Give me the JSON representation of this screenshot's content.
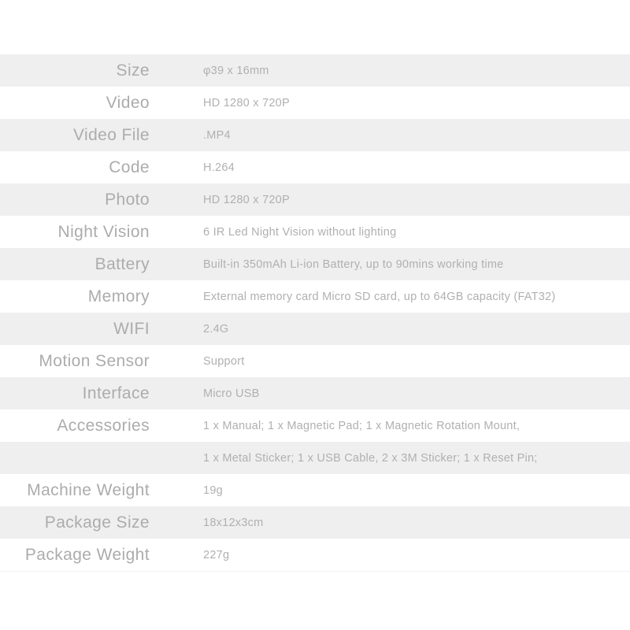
{
  "document": {
    "type": "product-specification-table",
    "colors": {
      "background": "#ffffff",
      "stripe": "#efefef",
      "label_text": "#acacac",
      "value_text": "#b0b0b0"
    }
  },
  "spec_table": {
    "rows": [
      {
        "label": "Size",
        "value": "φ39 x 16mm"
      },
      {
        "label": "Video",
        "value": "HD 1280 x 720P"
      },
      {
        "label": "Video File",
        "value": ".MP4"
      },
      {
        "label": "Code",
        "value": "H.264"
      },
      {
        "label": "Photo",
        "value": "HD 1280 x 720P"
      },
      {
        "label": "Night Vision",
        "value": "6 IR Led Night Vision without lighting"
      },
      {
        "label": "Battery",
        "value": "Built-in 350mAh Li-ion Battery, up to 90mins working time"
      },
      {
        "label": "Memory",
        "value": "External memory card Micro SD card, up to 64GB capacity (FAT32)"
      },
      {
        "label": "WIFI",
        "value": "2.4G"
      },
      {
        "label": "Motion Sensor",
        "value": "Support"
      },
      {
        "label": "Interface",
        "value": "Micro USB"
      },
      {
        "label": "Accessories",
        "value": "1 x Manual; 1 x Magnetic Pad; 1 x Magnetic Rotation Mount,"
      },
      {
        "label": "",
        "value": "1 x Metal Sticker; 1 x USB Cable, 2 x 3M Sticker; 1 x Reset Pin;"
      },
      {
        "label": "Machine Weight",
        "value": "19g"
      },
      {
        "label": "Package Size",
        "value": "18x12x3cm"
      },
      {
        "label": "Package Weight",
        "value": "227g"
      }
    ]
  }
}
